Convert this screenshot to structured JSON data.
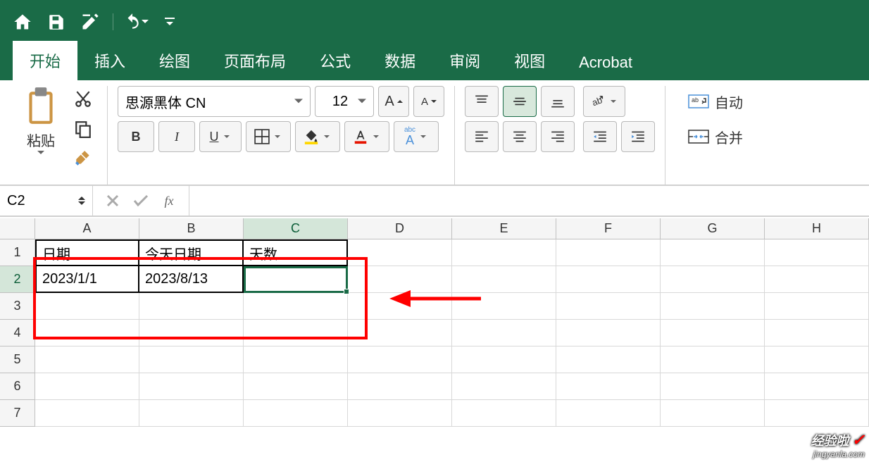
{
  "qat": {
    "home_icon": "home",
    "save_icon": "save",
    "edit_icon": "edit",
    "undo_icon": "undo"
  },
  "ribbon": {
    "tabs": [
      "开始",
      "插入",
      "绘图",
      "页面布局",
      "公式",
      "数据",
      "审阅",
      "视图",
      "Acrobat"
    ],
    "active_tab": 0,
    "paste_label": "粘贴",
    "font_name": "思源黑体 CN",
    "font_size": "12",
    "bold": "B",
    "italic": "I",
    "underline": "U",
    "phonetic": "abc",
    "wrap_text": "自动",
    "merge_text": "合并"
  },
  "formula_bar": {
    "name_box": "C2",
    "fx": "fx",
    "formula": ""
  },
  "sheet": {
    "columns": [
      "A",
      "B",
      "C",
      "D",
      "E",
      "F",
      "G",
      "H"
    ],
    "selected_col": "C",
    "selected_row": "2",
    "rows": [
      {
        "num": "1",
        "cells": [
          "日期",
          "今天日期",
          "天数",
          "",
          "",
          "",
          "",
          ""
        ]
      },
      {
        "num": "2",
        "cells": [
          "2023/1/1",
          "2023/8/13",
          "",
          "",
          "",
          "",
          "",
          ""
        ]
      },
      {
        "num": "3",
        "cells": [
          "",
          "",
          "",
          "",
          "",
          "",
          "",
          ""
        ]
      },
      {
        "num": "4",
        "cells": [
          "",
          "",
          "",
          "",
          "",
          "",
          "",
          ""
        ]
      },
      {
        "num": "5",
        "cells": [
          "",
          "",
          "",
          "",
          "",
          "",
          "",
          ""
        ]
      },
      {
        "num": "6",
        "cells": [
          "",
          "",
          "",
          "",
          "",
          "",
          "",
          ""
        ]
      },
      {
        "num": "7",
        "cells": [
          "",
          "",
          "",
          "",
          "",
          "",
          "",
          ""
        ]
      }
    ]
  },
  "watermark": {
    "line1": "经验啦",
    "line2": "jingyanla.com"
  }
}
